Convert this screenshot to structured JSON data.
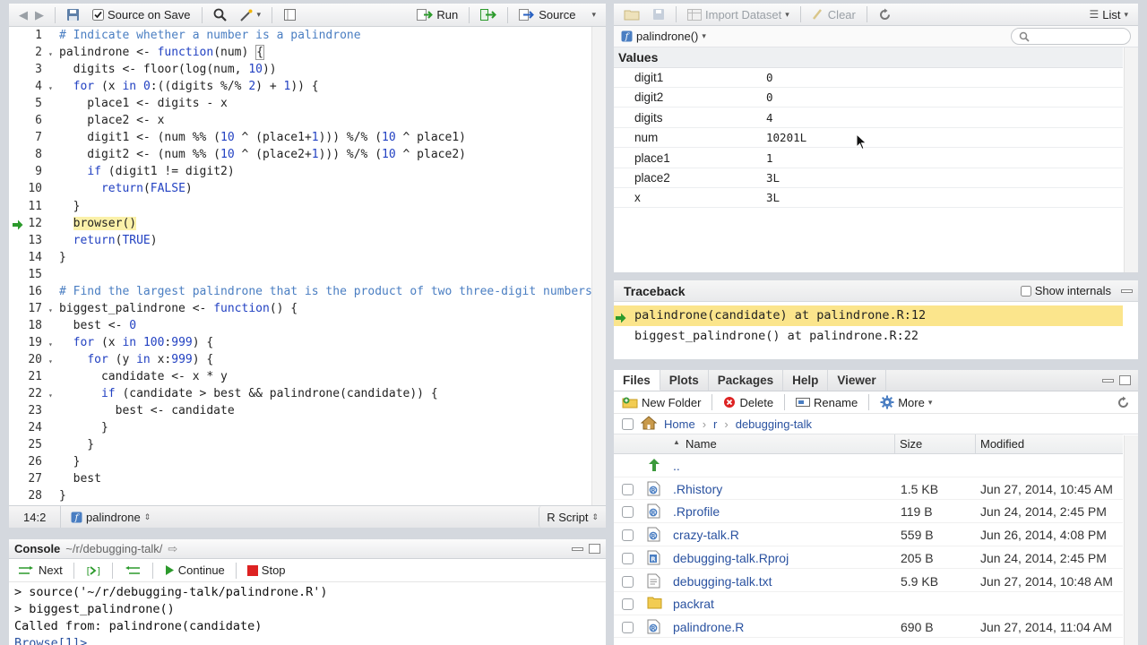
{
  "editor": {
    "toolbar": {
      "source_on_save": "Source on Save",
      "run": "Run",
      "source": "Source"
    },
    "lines": [
      {
        "n": "1",
        "html": "<span class='cm'># Indicate whether a number is a palindrone</span>"
      },
      {
        "n": "2",
        "html": "palindrone &lt;- <span class='kw'>function</span>(num) <span style='border:1px solid #999'>{</span>",
        "fold": true
      },
      {
        "n": "3",
        "html": "  digits &lt;- floor(log(num, <span class='nm'>10</span>))"
      },
      {
        "n": "4",
        "html": "  <span class='kw'>for</span> (x <span class='kw'>in</span> <span class='nm'>0</span>:((digits %/% <span class='nm'>2</span>) + <span class='nm'>1</span>)) {",
        "fold": true
      },
      {
        "n": "5",
        "html": "    place1 &lt;- digits - x"
      },
      {
        "n": "6",
        "html": "    place2 &lt;- x"
      },
      {
        "n": "7",
        "html": "    digit1 &lt;- (num %% (<span class='nm'>10</span> ^ (place1+<span class='nm'>1</span>))) %/% (<span class='nm'>10</span> ^ place1)"
      },
      {
        "n": "8",
        "html": "    digit2 &lt;- (num %% (<span class='nm'>10</span> ^ (place2+<span class='nm'>1</span>))) %/% (<span class='nm'>10</span> ^ place2)"
      },
      {
        "n": "9",
        "html": "    <span class='kw'>if</span> (digit1 != digit2)"
      },
      {
        "n": "10",
        "html": "      <span class='kw'>return</span>(<span class='kw'>FALSE</span>)"
      },
      {
        "n": "11",
        "html": "  }"
      },
      {
        "n": "12",
        "html": "  <span class='hl'>browser()</span>",
        "current": true
      },
      {
        "n": "13",
        "html": "  <span class='kw'>return</span>(<span class='kw'>TRUE</span>)"
      },
      {
        "n": "14",
        "html": "}"
      },
      {
        "n": "15",
        "html": ""
      },
      {
        "n": "16",
        "html": "<span class='cm'># Find the largest palindrone that is the product of two three-digit numbers</span>"
      },
      {
        "n": "17",
        "html": "biggest_palindrone &lt;- <span class='kw'>function</span>() {",
        "fold": true
      },
      {
        "n": "18",
        "html": "  best &lt;- <span class='nm'>0</span>"
      },
      {
        "n": "19",
        "html": "  <span class='kw'>for</span> (x <span class='kw'>in</span> <span class='nm'>100</span>:<span class='nm'>999</span>) {",
        "fold": true
      },
      {
        "n": "20",
        "html": "    <span class='kw'>for</span> (y <span class='kw'>in</span> x:<span class='nm'>999</span>) {",
        "fold": true
      },
      {
        "n": "21",
        "html": "      candidate &lt;- x * y"
      },
      {
        "n": "22",
        "html": "      <span class='kw'>if</span> (candidate &gt; best &amp;&amp; palindrone(candidate)) {",
        "fold": true
      },
      {
        "n": "23",
        "html": "        best &lt;- candidate"
      },
      {
        "n": "24",
        "html": "      }"
      },
      {
        "n": "25",
        "html": "    }"
      },
      {
        "n": "26",
        "html": "  }"
      },
      {
        "n": "27",
        "html": "  best"
      },
      {
        "n": "28",
        "html": "}"
      }
    ],
    "status": {
      "position": "14:2",
      "function": "palindrone",
      "filetype": "R Script"
    }
  },
  "console": {
    "title": "Console",
    "path": "~/r/debugging-talk/",
    "next": "Next",
    "continue": "Continue",
    "stop": "Stop",
    "lines": [
      "> source('~/r/debugging-talk/palindrone.R')",
      "> biggest_palindrone()",
      "Called from: palindrone(candidate)",
      "Browse[1]>"
    ]
  },
  "environment": {
    "import_dataset": "Import Dataset",
    "clear": "Clear",
    "list": "List",
    "scope": "palindrone()",
    "values_header": "Values",
    "vars": [
      {
        "name": "digit1",
        "value": "0"
      },
      {
        "name": "digit2",
        "value": "0"
      },
      {
        "name": "digits",
        "value": "4"
      },
      {
        "name": "num",
        "value": "10201L"
      },
      {
        "name": "place1",
        "value": "1"
      },
      {
        "name": "place2",
        "value": "3L"
      },
      {
        "name": "x",
        "value": "3L"
      }
    ]
  },
  "traceback": {
    "title": "Traceback",
    "show_internals": "Show internals",
    "frames": [
      {
        "text": "palindrone(candidate) at palindrone.R:12",
        "current": true
      },
      {
        "text": "biggest_palindrone() at palindrone.R:22",
        "current": false
      }
    ]
  },
  "files": {
    "tabs": [
      "Files",
      "Plots",
      "Packages",
      "Help",
      "Viewer"
    ],
    "new_folder": "New Folder",
    "delete": "Delete",
    "rename": "Rename",
    "more": "More",
    "breadcrumb": {
      "home": "Home",
      "r": "r",
      "folder": "debugging-talk"
    },
    "columns": {
      "name": "Name",
      "size": "Size",
      "modified": "Modified"
    },
    "rows": [
      {
        "name": "..",
        "size": "",
        "modified": "",
        "icon": "up"
      },
      {
        "name": ".Rhistory",
        "size": "1.5 KB",
        "modified": "Jun 27, 2014, 10:45 AM",
        "icon": "rdoc"
      },
      {
        "name": ".Rprofile",
        "size": "119 B",
        "modified": "Jun 24, 2014, 2:45 PM",
        "icon": "rdoc"
      },
      {
        "name": "crazy-talk.R",
        "size": "559 B",
        "modified": "Jun 26, 2014, 4:08 PM",
        "icon": "rdoc"
      },
      {
        "name": "debugging-talk.Rproj",
        "size": "205 B",
        "modified": "Jun 24, 2014, 2:45 PM",
        "icon": "rproj"
      },
      {
        "name": "debugging-talk.txt",
        "size": "5.9 KB",
        "modified": "Jun 27, 2014, 10:48 AM",
        "icon": "txt"
      },
      {
        "name": "packrat",
        "size": "",
        "modified": "",
        "icon": "folder"
      },
      {
        "name": "palindrone.R",
        "size": "690 B",
        "modified": "Jun 27, 2014, 11:04 AM",
        "icon": "rdoc"
      }
    ]
  },
  "colors": {
    "accent": "#2a52a0",
    "highlight": "#fbe58c",
    "current_line": "#fbf1a9",
    "green": "#2c9a2c",
    "red": "#d22"
  }
}
